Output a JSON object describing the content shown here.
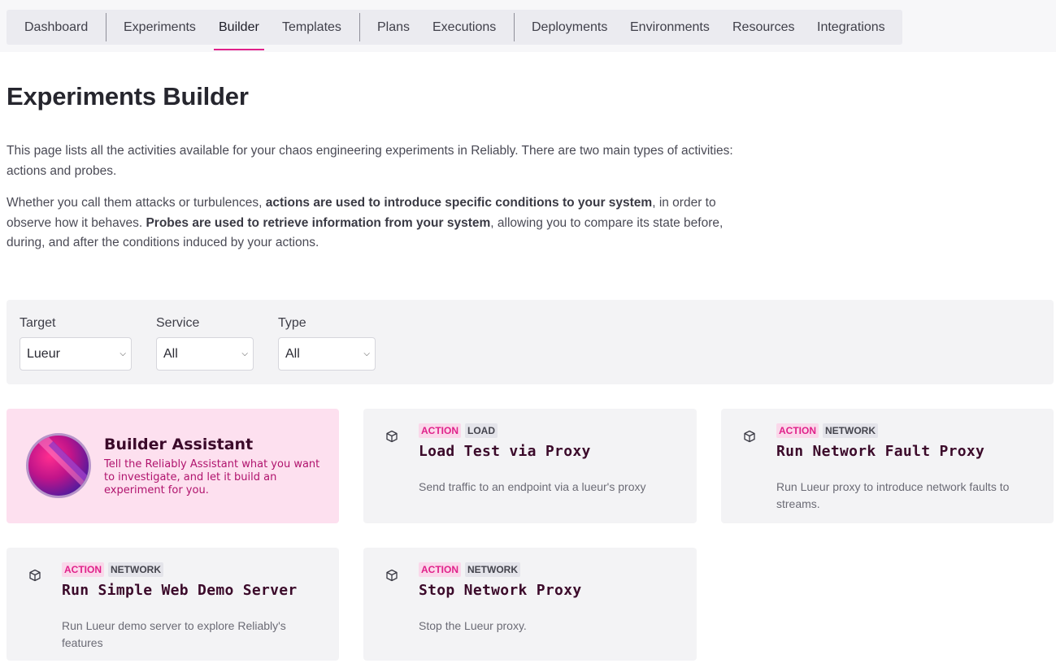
{
  "nav": {
    "tabs": [
      {
        "label": "Dashboard"
      },
      {
        "label": "Experiments"
      },
      {
        "label": "Builder",
        "active": true
      },
      {
        "label": "Templates"
      },
      {
        "label": "Plans"
      },
      {
        "label": "Executions"
      },
      {
        "label": "Deployments"
      },
      {
        "label": "Environments"
      },
      {
        "label": "Resources"
      },
      {
        "label": "Integrations"
      }
    ],
    "accent_color": "#e0218a"
  },
  "page": {
    "title": "Experiments Builder",
    "intro_p1": "This page lists all the activities available for your chaos engineering experiments in Reliably. There are two main types of activities: actions and probes.",
    "intro_p2": {
      "a": "Whether you call them attacks or turbulences, ",
      "b": "actions are used to introduce specific conditions to your system",
      "c": ", in order to observe how it behaves. ",
      "d": "Probes are used to retrieve information from your system",
      "e": ", allowing you to compare its state before, during, and after the conditions induced by your actions."
    }
  },
  "filters": {
    "target": {
      "label": "Target",
      "value": "Lueur"
    },
    "service": {
      "label": "Service",
      "value": "All"
    },
    "type": {
      "label": "Type",
      "value": "All"
    }
  },
  "assistant": {
    "title": "Builder Assistant",
    "description": "Tell the Reliably Assistant what you want to investigate, and let it build an experiment for you."
  },
  "cards": [
    {
      "badge1": "ACTION",
      "badge2": "LOAD",
      "title": "Load Test via Proxy",
      "description": "Send traffic to an endpoint via a lueur's proxy",
      "icon": "cube-icon"
    },
    {
      "badge1": "ACTION",
      "badge2": "NETWORK",
      "title": "Run Network Fault Proxy",
      "description": "Run Lueur proxy to introduce network faults to streams.",
      "icon": "cube-icon"
    },
    {
      "badge1": "ACTION",
      "badge2": "NETWORK",
      "title": "Run Simple Web Demo Server",
      "description": "Run Lueur demo server to explore Reliably's features",
      "icon": "cube-icon"
    },
    {
      "badge1": "ACTION",
      "badge2": "NETWORK",
      "title": "Stop Network Proxy",
      "description": "Stop the Lueur proxy.",
      "icon": "cube-icon"
    }
  ]
}
